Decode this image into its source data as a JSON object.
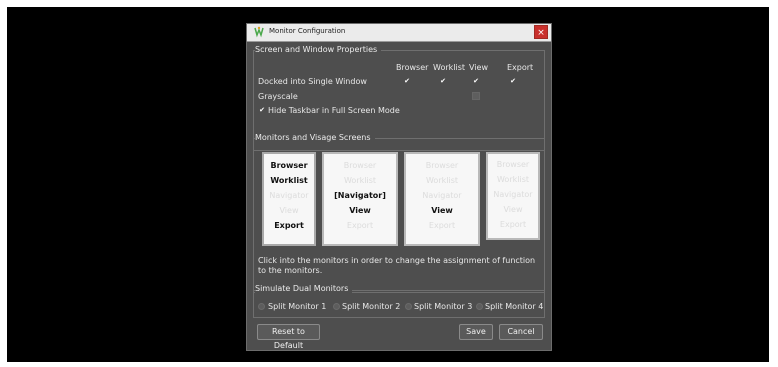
{
  "window": {
    "title": "Monitor Configuration",
    "close_glyph": "×",
    "icon": "app-icon"
  },
  "props": {
    "title": "Screen and Window Properties",
    "columns": [
      "Browser",
      "Worklist",
      "View",
      "Export"
    ],
    "rows": [
      {
        "label": "Docked into Single Window",
        "values": [
          true,
          true,
          true,
          true
        ]
      },
      {
        "label": "Grayscale",
        "values": [
          null,
          null,
          false,
          null
        ]
      }
    ],
    "hide_taskbar": {
      "label": "Hide Taskbar in Full Screen Mode",
      "checked": true
    }
  },
  "monitors": {
    "title": "Monitors and Visage Screens",
    "screens": [
      {
        "items": [
          "Browser",
          "Worklist",
          "Navigator",
          "View",
          "Export"
        ],
        "active": [
          true,
          true,
          false,
          false,
          true
        ]
      },
      {
        "items": [
          "Browser",
          "Worklist",
          "[Navigator]",
          "View",
          "Export"
        ],
        "active": [
          false,
          false,
          true,
          true,
          false
        ]
      },
      {
        "items": [
          "Browser",
          "Worklist",
          "Navigator",
          "View",
          "Export"
        ],
        "active": [
          false,
          false,
          false,
          true,
          false
        ]
      },
      {
        "items": [
          "Browser",
          "Worklist",
          "Navigator",
          "View",
          "Export"
        ],
        "active": [
          false,
          false,
          false,
          false,
          false
        ]
      }
    ],
    "hint": "Click into the monitors in order to change the assignment of function to the monitors."
  },
  "dual": {
    "title": "Simulate Dual Monitors",
    "options": [
      "Split Monitor 1",
      "Split Monitor 2",
      "Split Monitor 3",
      "Split Monitor 4"
    ]
  },
  "buttons": {
    "reset": "Reset to Default",
    "save": "Save",
    "cancel": "Cancel"
  },
  "colors": {
    "dialog_bg": "#4e4e4e",
    "close": "#c9302c"
  }
}
